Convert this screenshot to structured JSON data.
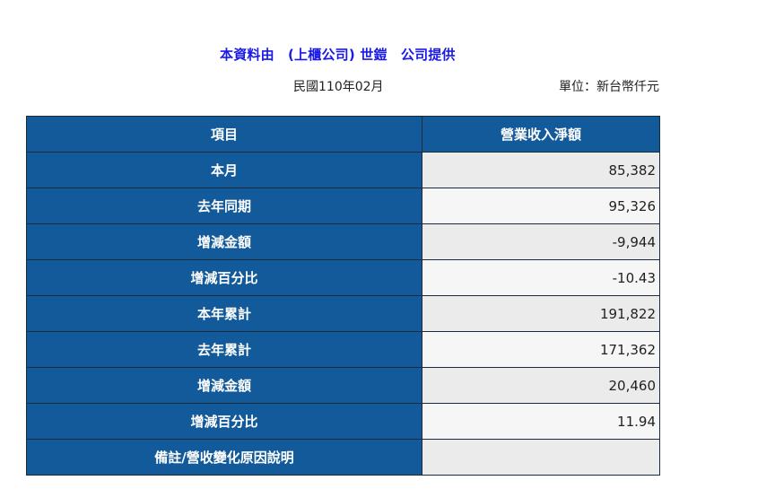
{
  "header": {
    "title": "本資料由　(上櫃公司) 世鎧　公司提供",
    "period": "民國110年02月",
    "unit": "單位：新台幣仟元"
  },
  "table": {
    "columns": [
      "項目",
      "營業收入淨額"
    ],
    "rows": [
      {
        "label": "本月",
        "value": "85,382"
      },
      {
        "label": "去年同期",
        "value": "95,326"
      },
      {
        "label": "增減金額",
        "value": "-9,944"
      },
      {
        "label": "增減百分比",
        "value": "-10.43"
      },
      {
        "label": "本年累計",
        "value": "191,822"
      },
      {
        "label": "去年累計",
        "value": "171,362"
      },
      {
        "label": "增減金額",
        "value": "20,460"
      },
      {
        "label": "增減百分比",
        "value": "11.94"
      },
      {
        "label": "備註/營收變化原因說明",
        "value": ""
      }
    ]
  }
}
